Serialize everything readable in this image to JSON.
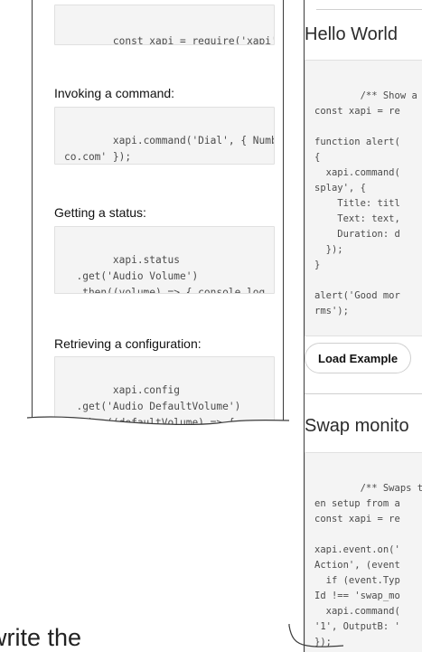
{
  "left_doc": {
    "import_snippet": "const xapi = require('xapi');",
    "sections": [
      {
        "heading": "Invoking a command:",
        "code": "xapi.command('Dial', { Number: 'm\nco.com' });"
      },
      {
        "heading": "Getting a status:",
        "code": "xapi.status\n  .get('Audio Volume')\n  .then((volume) => { console.log"
      },
      {
        "heading": "Retrieving a configuration:",
        "code": "xapi.config\n  .get('Audio DefaultVolume')\n  .then((defaultVolume) => {"
      }
    ]
  },
  "right_examples": {
    "hello": {
      "title": "Hello World",
      "code": "/** Show a mess\nconst xapi = re\n\nfunction alert(\n{\n  xapi.command(\nsplay', {\n    Title: titl\n    Text: text,\n    Duration: d\n  });\n}\n\nalert('Good mor\nrms');",
      "button_label": "Load Example"
    },
    "swap": {
      "title": "Swap monito",
      "code": "/** Swaps the c\nen setup from a\nconst xapi = re\n\nxapi.event.on('\nAction', (event\n  if (event.Typ\nId !== 'swap_mo\n  xapi.command(\n'1', OutputB: '\n});"
    }
  },
  "bottom_fragment": "write the"
}
